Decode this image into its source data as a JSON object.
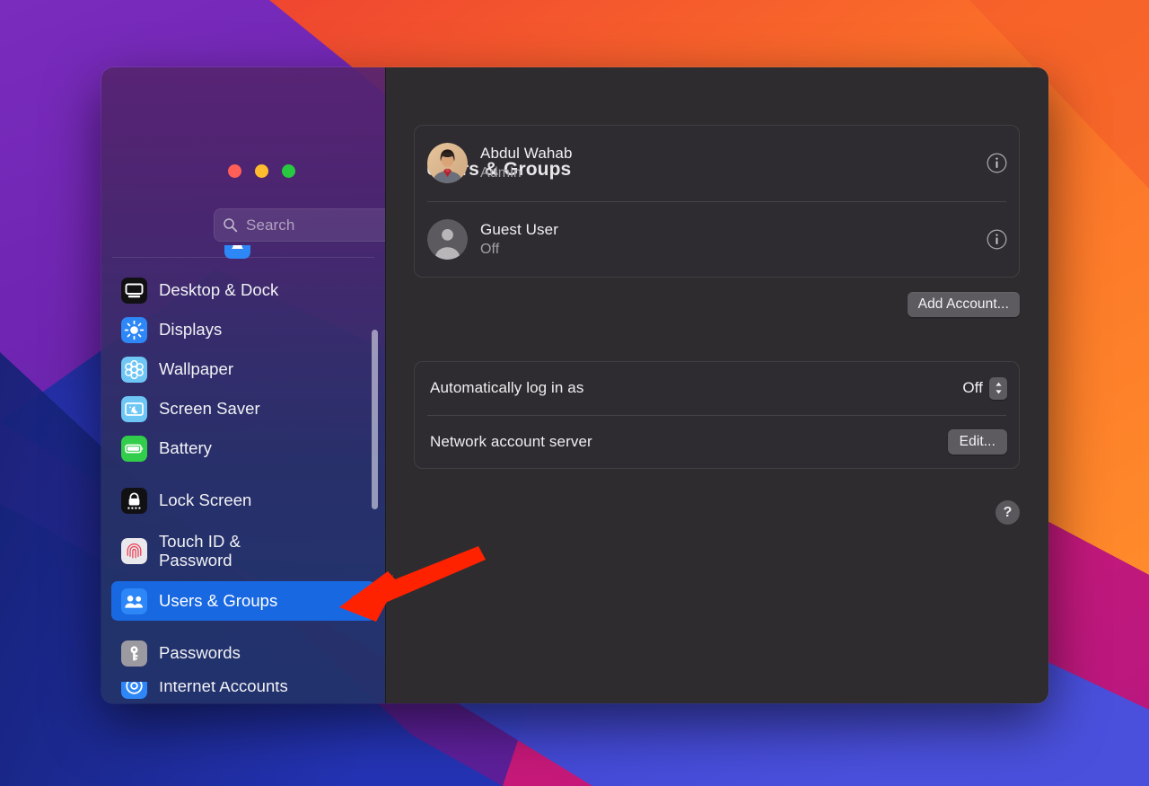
{
  "wallpaper": {
    "colors": [
      "#6a22ab",
      "#f2542b",
      "#ff7a2f",
      "#e01d6a",
      "#c4187e",
      "#2b39c9",
      "#3a46d8",
      "#1f2c9e"
    ]
  },
  "window": {
    "traffic_lights": [
      {
        "name": "close",
        "color": "#ff5f57"
      },
      {
        "name": "minimize",
        "color": "#febc2e"
      },
      {
        "name": "maximize",
        "color": "#28c840"
      }
    ]
  },
  "sidebar": {
    "search": {
      "placeholder": "Search",
      "value": "",
      "icon": "search-icon"
    },
    "scroll_position_hint": "partially scrolled",
    "clipped_top_item": {
      "label": "",
      "icon": "notifications-icon"
    },
    "group_one": [
      {
        "label": "Desktop & Dock",
        "icon": "desktop-and-dock-icon",
        "selected": false
      },
      {
        "label": "Displays",
        "icon": "displays-icon",
        "selected": false
      },
      {
        "label": "Wallpaper",
        "icon": "wallpaper-icon",
        "selected": false
      },
      {
        "label": "Screen Saver",
        "icon": "screen-saver-icon",
        "selected": false
      },
      {
        "label": "Battery",
        "icon": "battery-icon",
        "selected": false
      }
    ],
    "group_two": [
      {
        "label": "Lock Screen",
        "icon": "lock-screen-icon",
        "selected": false
      },
      {
        "label": "Touch ID &\nPassword",
        "label_line1": "Touch ID &",
        "label_line2": "Password",
        "icon": "touch-id-icon",
        "selected": false
      },
      {
        "label": "Users & Groups",
        "icon": "users-and-groups-icon",
        "selected": true
      }
    ],
    "group_three": [
      {
        "label": "Passwords",
        "icon": "passwords-icon",
        "selected": false
      },
      {
        "label": "Internet Accounts",
        "icon": "internet-accounts-icon",
        "selected": false,
        "clipped": true
      }
    ],
    "selected_accent": "#1868e2"
  },
  "main": {
    "title": "Users & Groups",
    "users": [
      {
        "name": "Abdul Wahab",
        "role": "Admin",
        "avatar": "user-photo-avatar",
        "info_label": "i"
      },
      {
        "name": "Guest User",
        "role": "Off",
        "avatar": "generic-person-avatar",
        "info_label": "i"
      }
    ],
    "add_account_label": "Add Account...",
    "options": [
      {
        "label": "Automatically log in as",
        "control": "popup",
        "value": "Off"
      },
      {
        "label": "Network account server",
        "control": "button",
        "value": "Edit..."
      }
    ],
    "help_label": "?"
  },
  "annotation": {
    "arrow_color": "#ff2200",
    "points_to": "sidebar-item-users-and-groups"
  }
}
